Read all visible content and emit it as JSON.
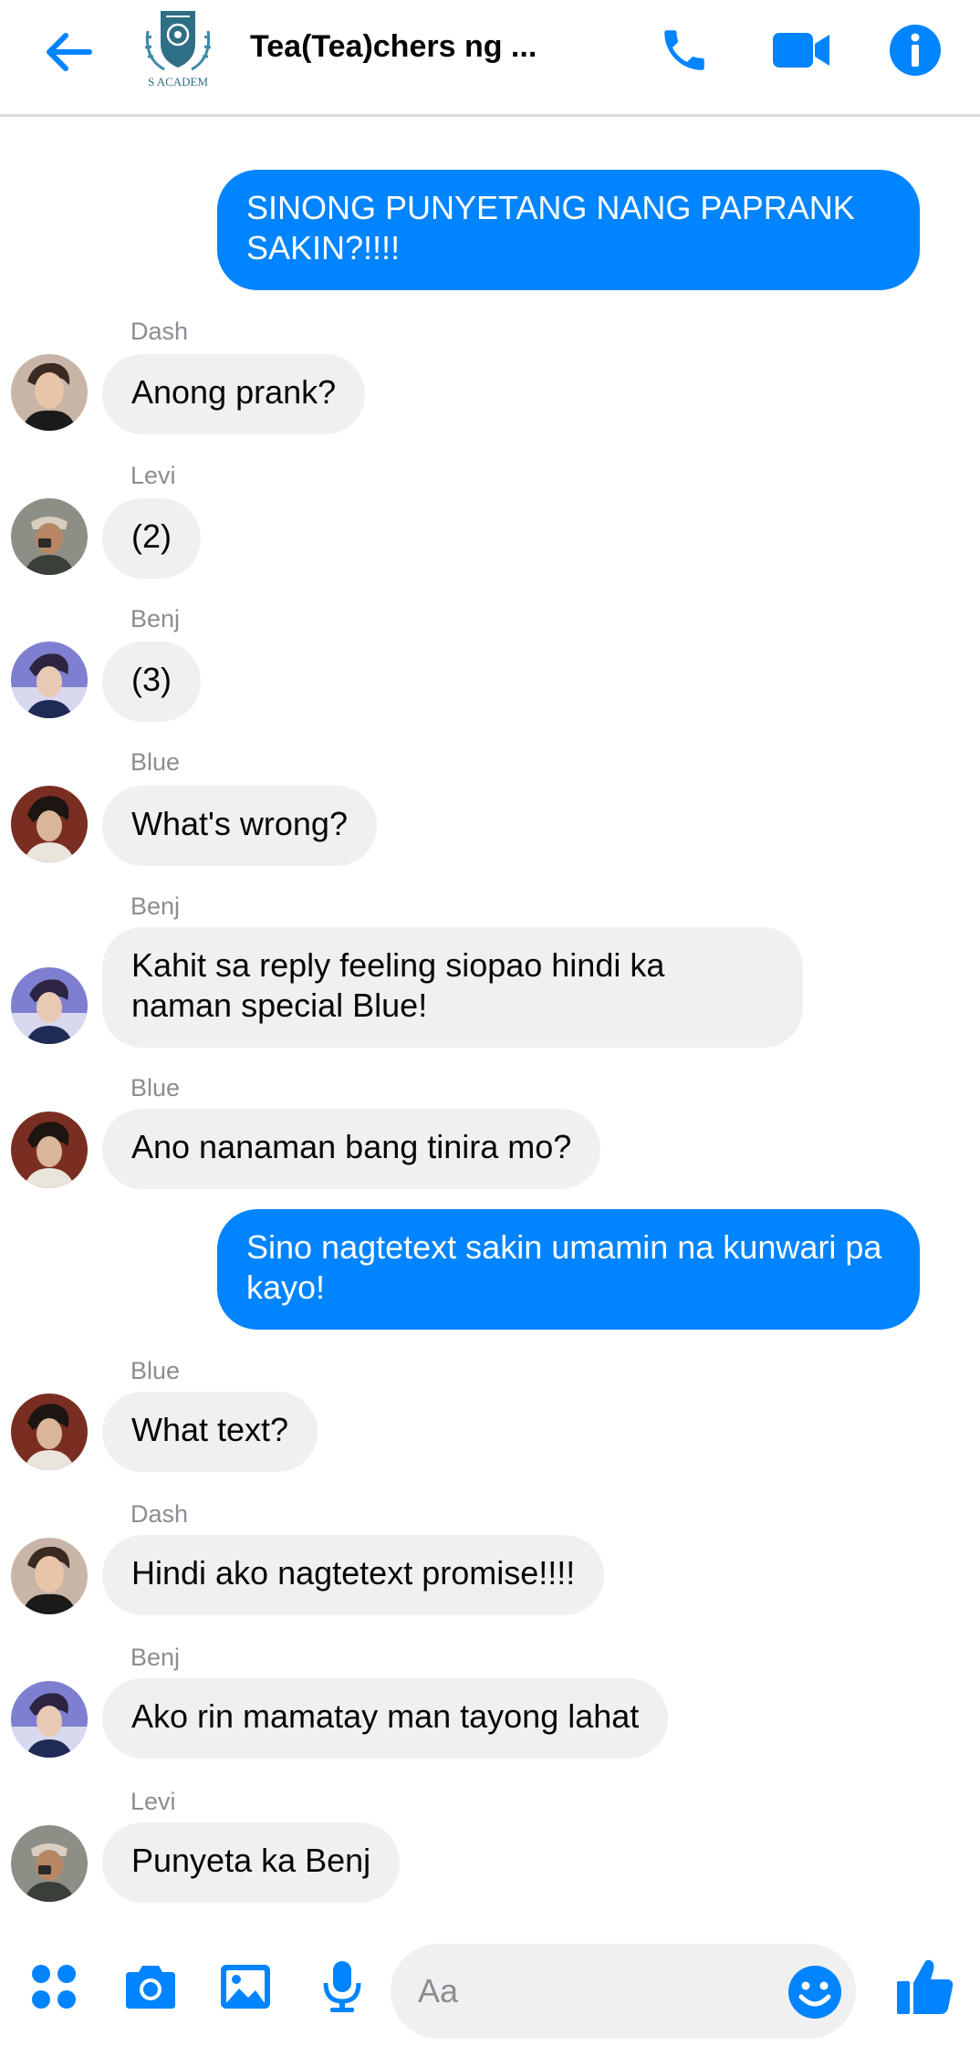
{
  "header": {
    "title": "Tea(Tea)chers ng ...",
    "logo_text": "S ACADEM"
  },
  "colors": {
    "accent": "#0084ff",
    "incoming_bubble": "#f0f0f0",
    "muted_text": "#8a8d91"
  },
  "messages": [
    {
      "direction": "outgoing",
      "text": "SINONG PUNYETANG NANG PAPRANK SAKIN?!!!!"
    },
    {
      "direction": "incoming",
      "sender": "Dash",
      "text": "Anong prank?"
    },
    {
      "direction": "incoming",
      "sender": "Levi",
      "text": "(2)"
    },
    {
      "direction": "incoming",
      "sender": "Benj",
      "text": "(3)"
    },
    {
      "direction": "incoming",
      "sender": "Blue",
      "text": "What's wrong?"
    },
    {
      "direction": "incoming",
      "sender": "Benj",
      "text": "Kahit sa reply feeling siopao hindi ka naman special Blue!"
    },
    {
      "direction": "incoming",
      "sender": "Blue",
      "text": "Ano nanaman bang tinira mo?"
    },
    {
      "direction": "outgoing",
      "text": "Sino nagtetext sakin umamin na kunwari pa kayo!"
    },
    {
      "direction": "incoming",
      "sender": "Blue",
      "text": "What text?"
    },
    {
      "direction": "incoming",
      "sender": "Dash",
      "text": "Hindi ako nagtetext promise!!!!"
    },
    {
      "direction": "incoming",
      "sender": "Benj",
      "text": "Ako rin mamatay man tayong lahat"
    },
    {
      "direction": "incoming",
      "sender": "Levi",
      "text": "Punyeta ka Benj"
    }
  ],
  "composer": {
    "placeholder": "Aa"
  },
  "icons": {
    "back": "arrow-left-icon",
    "call": "phone-icon",
    "video": "video-camera-icon",
    "info": "info-icon",
    "menu": "four-dots-icon",
    "camera": "camera-icon",
    "gallery": "image-icon",
    "mic": "microphone-icon",
    "emoji": "smiley-icon",
    "like": "thumbs-up-icon"
  }
}
